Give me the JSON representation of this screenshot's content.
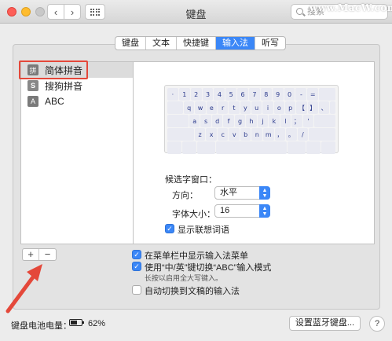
{
  "window": {
    "title": "键盘"
  },
  "watermark": "www.MacW.com",
  "search": {
    "placeholder": "搜索"
  },
  "tabs": [
    {
      "label": "键盘",
      "active": false
    },
    {
      "label": "文本",
      "active": false
    },
    {
      "label": "快捷键",
      "active": false
    },
    {
      "label": "输入法",
      "active": true
    },
    {
      "label": "听写",
      "active": false
    }
  ],
  "sources": [
    {
      "icon": "拼",
      "label": "简体拼音",
      "selected": true
    },
    {
      "icon": "S",
      "label": "搜狗拼音",
      "selected": false
    },
    {
      "icon": "A",
      "label": "ABC",
      "selected": false
    }
  ],
  "keyboard": {
    "rows": [
      [
        "·",
        "1",
        "2",
        "3",
        "4",
        "5",
        "6",
        "7",
        "8",
        "9",
        "0",
        "-",
        "="
      ],
      [
        "q",
        "w",
        "e",
        "r",
        "t",
        "y",
        "u",
        "i",
        "o",
        "p",
        "【",
        "】",
        "、"
      ],
      [
        "a",
        "s",
        "d",
        "f",
        "g",
        "h",
        "j",
        "k",
        "l",
        "；",
        "'"
      ],
      [
        "z",
        "x",
        "c",
        "v",
        "b",
        "n",
        "m",
        "，",
        "。",
        "/"
      ]
    ]
  },
  "options": {
    "candidate_window_label": "候选字窗口：",
    "orientation_label": "方向：",
    "orientation_value": "水平",
    "font_size_label": "字体大小：",
    "font_size_value": "16",
    "show_suggestions_label": "显示联想词语",
    "show_suggestions_checked": true
  },
  "bottom_options": {
    "show_menu_label": "在菜单栏中显示输入法菜单",
    "show_menu_checked": true,
    "toggle_abc_label": "使用“中/英”键切换“ABC”输入模式",
    "toggle_abc_checked": true,
    "toggle_abc_note": "长按以启用全大写键入。",
    "auto_switch_label": "自动切换到文稿的输入法",
    "auto_switch_checked": false
  },
  "footer": {
    "battery_label": "键盘电池电量：",
    "battery_percent": "62%",
    "bt_button": "设置蓝牙键盘...",
    "help": "?"
  },
  "colors": {
    "accent": "#3b87f7",
    "highlight": "#e4483a"
  }
}
